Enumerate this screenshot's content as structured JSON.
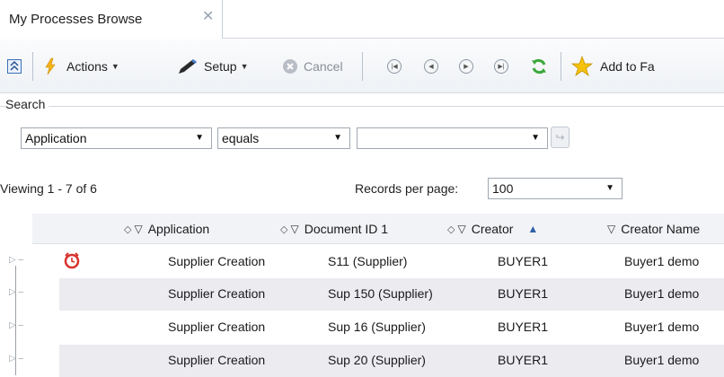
{
  "tab": {
    "title": "My Processes Browse",
    "close_glyph": "✕"
  },
  "toolbar": {
    "collapse_icon": "collapse-icon",
    "actions_label": "Actions",
    "setup_label": "Setup",
    "cancel_label": "Cancel",
    "favorites_label": "Add to Fa"
  },
  "search": {
    "legend": "Search",
    "field_value": "Application",
    "operator_value": "equals",
    "value_value": ""
  },
  "paging": {
    "viewing_text": "Viewing 1 - 7  of  6",
    "records_per_page_label": "Records per page:",
    "records_per_page_value": "100"
  },
  "grid": {
    "columns": [
      {
        "label": "Application"
      },
      {
        "label": "Document ID 1"
      },
      {
        "label": "Creator"
      },
      {
        "label": "Creator Name"
      }
    ],
    "rows": [
      {
        "application": "Supplier Creation",
        "document_id": "S11 (Supplier)",
        "creator": "BUYER1",
        "creator_name": "Buyer1 demo",
        "alarm": true
      },
      {
        "application": "Supplier Creation",
        "document_id": "Sup 150 (Supplier)",
        "creator": "BUYER1",
        "creator_name": "Buyer1 demo",
        "alarm": false
      },
      {
        "application": "Supplier Creation",
        "document_id": "Sup 16 (Supplier)",
        "creator": "BUYER1",
        "creator_name": "Buyer1 demo",
        "alarm": false
      },
      {
        "application": "Supplier Creation",
        "document_id": "Sup 20 (Supplier)",
        "creator": "BUYER1",
        "creator_name": "Buyer1 demo",
        "alarm": false
      }
    ]
  },
  "colors": {
    "row_alt": "#ebebf0",
    "header_bg": "#f1f3f6",
    "accent_star": "#f4c20d",
    "refresh_green": "#3aa83a",
    "alarm_red": "#d9302c"
  }
}
